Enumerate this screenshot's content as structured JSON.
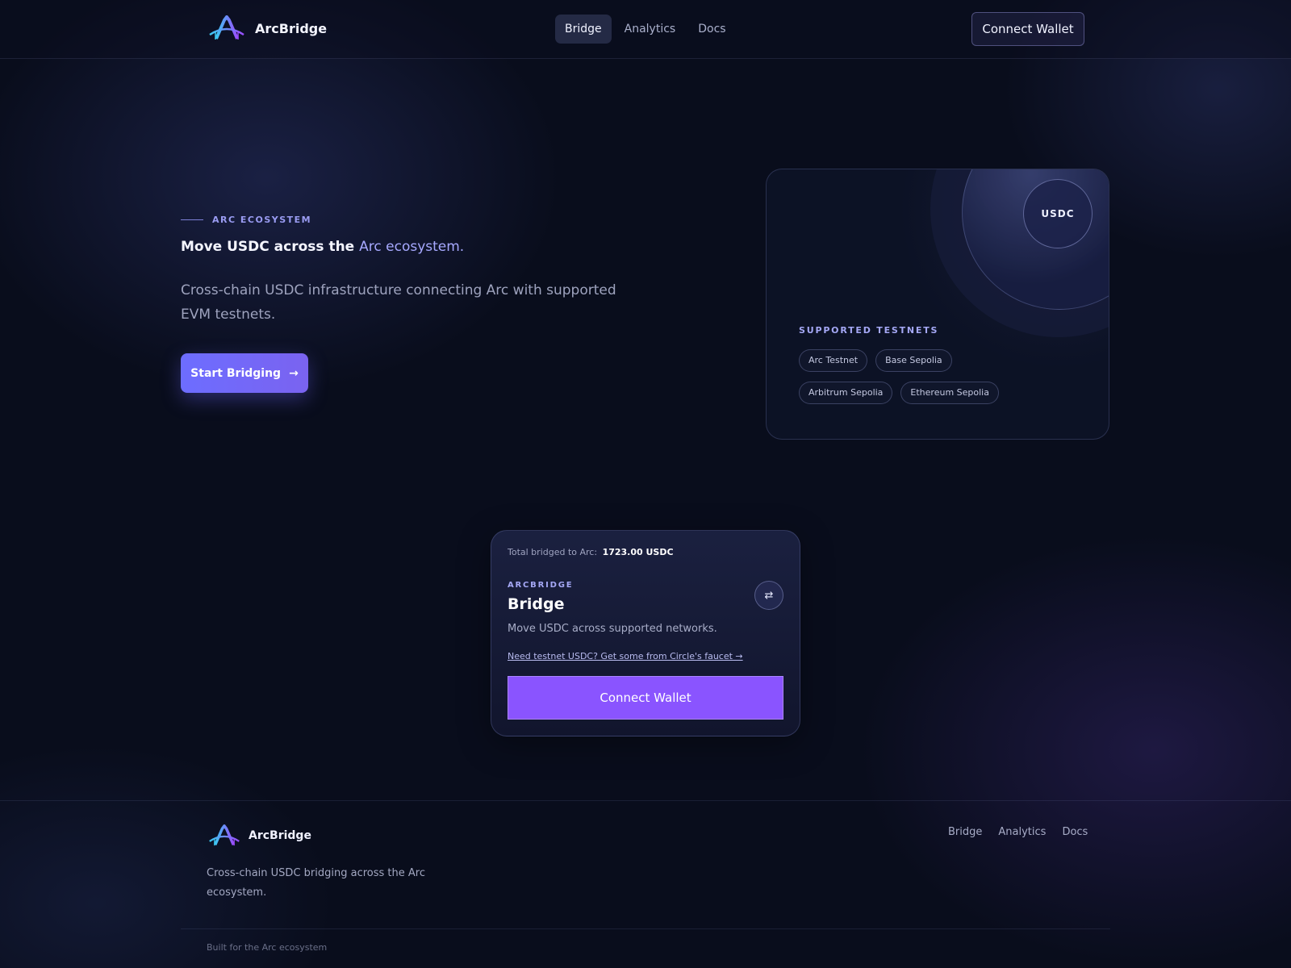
{
  "header": {
    "brand": "ArcBridge",
    "nav": [
      {
        "label": "Bridge",
        "active": true
      },
      {
        "label": "Analytics",
        "active": false
      },
      {
        "label": "Docs",
        "active": false
      }
    ],
    "connect_label": "Connect Wallet"
  },
  "hero": {
    "eyebrow": "ARC ECOSYSTEM",
    "title_main": "Move USDC across the",
    "title_accent": "Arc ecosystem.",
    "subtitle": "Cross-chain USDC infrastructure connecting Arc with supported EVM testnets.",
    "cta_label": "Start Bridging"
  },
  "testnets": {
    "badge": "USDC",
    "label": "SUPPORTED TESTNETS",
    "rows": [
      [
        "Arc Testnet",
        "Base Sepolia"
      ],
      [
        "Arbitrum Sepolia",
        "Ethereum Sepolia"
      ]
    ]
  },
  "bridge": {
    "total_label": "Total bridged to Arc:",
    "total_value": "1723.00 USDC",
    "eyebrow": "ARCBRIDGE",
    "title": "Bridge",
    "description": "Move USDC across supported networks.",
    "faucet_link": "Need testnet USDC? Get some from Circle's faucet →",
    "connect_label": "Connect Wallet"
  },
  "footer": {
    "brand": "ArcBridge",
    "description": "Cross-chain USDC bridging across the Arc ecosystem.",
    "nav": [
      "Bridge",
      "Analytics",
      "Docs"
    ],
    "credit": "Built for the Arc ecosystem"
  },
  "colors": {
    "background": "#090d1c",
    "accent": "#a7a9ff",
    "primary_button": "#6d6dff",
    "connect_button": "#8a54ff"
  },
  "icons": {
    "logo": "arc-bridge-logo-icon",
    "cta_arrow": "arrow-right-icon",
    "swap": "swap-arrows-icon"
  }
}
